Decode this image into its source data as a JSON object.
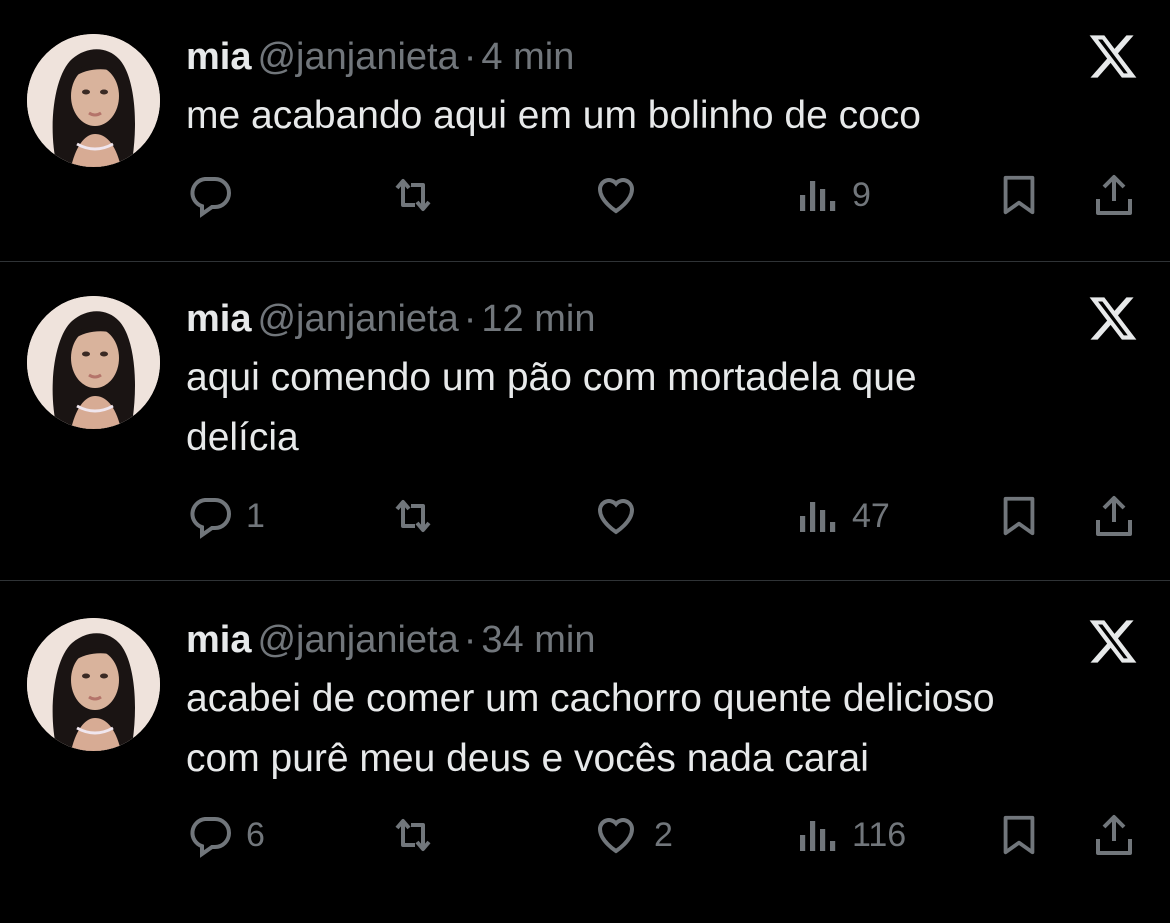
{
  "colors": {
    "background": "#000000",
    "text_primary": "#e7e9ea",
    "text_secondary": "#71767b",
    "divider": "#2f3336"
  },
  "tweets": [
    {
      "display_name": "mia",
      "handle": "@janjanieta",
      "separator": "·",
      "time": "4 min",
      "text": "me acabando aqui em um bolinho de coco",
      "counts": {
        "replies": "",
        "retweets": "",
        "likes": "",
        "views": "9"
      },
      "icons": [
        "reply-icon",
        "retweet-icon",
        "like-icon",
        "views-icon",
        "bookmark-icon",
        "share-icon",
        "x-logo-icon"
      ]
    },
    {
      "display_name": "mia",
      "handle": "@janjanieta",
      "separator": "·",
      "time": "12 min",
      "text": "aqui comendo um pão com mortadela que\ndelícia",
      "counts": {
        "replies": "1",
        "retweets": "",
        "likes": "",
        "views": "47"
      },
      "icons": [
        "reply-icon",
        "retweet-icon",
        "like-icon",
        "views-icon",
        "bookmark-icon",
        "share-icon",
        "x-logo-icon"
      ]
    },
    {
      "display_name": "mia",
      "handle": "@janjanieta",
      "separator": "·",
      "time": "34 min",
      "text": "acabei de comer um cachorro quente delicioso\ncom purê meu deus e vocês nada carai",
      "counts": {
        "replies": "6",
        "retweets": "",
        "likes": "2",
        "views": "116"
      },
      "icons": [
        "reply-icon",
        "retweet-icon",
        "like-icon",
        "views-icon",
        "bookmark-icon",
        "share-icon",
        "x-logo-icon"
      ]
    }
  ]
}
